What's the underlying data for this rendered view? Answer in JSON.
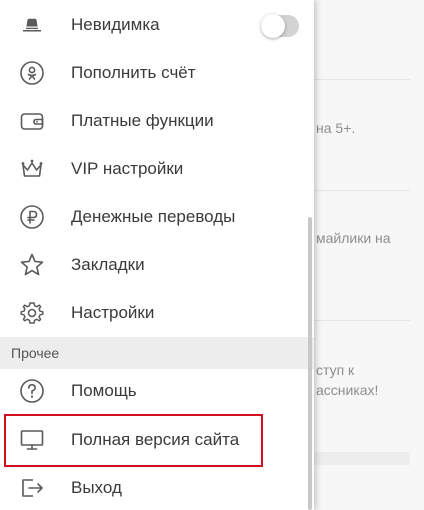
{
  "menu": {
    "items": [
      {
        "label": "Невидимка",
        "icon": "hat-icon"
      },
      {
        "label": "Пополнить счёт",
        "icon": "ok-coin-icon"
      },
      {
        "label": "Платные функции",
        "icon": "wallet-icon"
      },
      {
        "label": "VIP настройки",
        "icon": "crown-icon"
      },
      {
        "label": "Денежные переводы",
        "icon": "ruble-icon"
      },
      {
        "label": "Закладки",
        "icon": "star-icon"
      },
      {
        "label": "Настройки",
        "icon": "gear-icon"
      }
    ],
    "section_title": "Прочее",
    "other_items": [
      {
        "label": "Помощь",
        "icon": "help-icon"
      },
      {
        "label": "Полная версия сайта",
        "icon": "monitor-icon"
      },
      {
        "label": "Выход",
        "icon": "exit-icon"
      }
    ],
    "invisible_toggle_on": false
  },
  "background": {
    "snippets": [
      "на 5+.",
      "майлики на",
      "ступ к",
      "ассниках!"
    ]
  },
  "colors": {
    "highlight": "#d0101e",
    "text": "#3a3a3a",
    "section_bg": "#ededed"
  }
}
